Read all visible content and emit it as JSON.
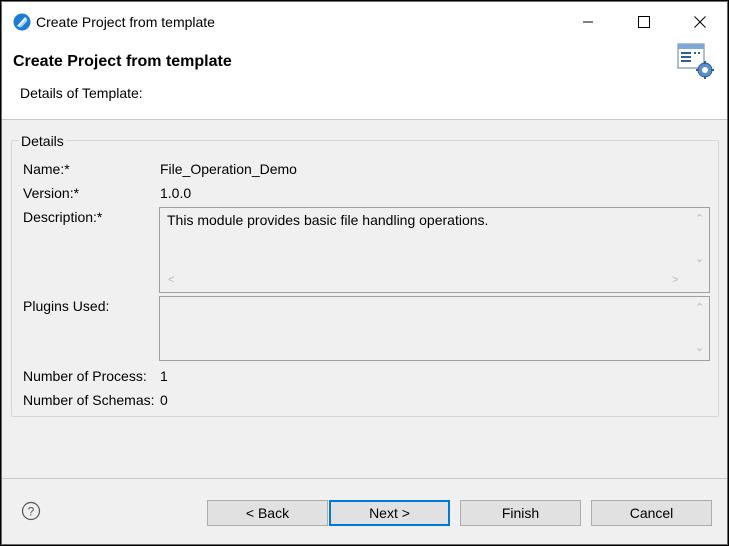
{
  "window": {
    "title": "Create Project from template"
  },
  "header": {
    "title": "Create Project from template",
    "subtitle": "Details of Template:"
  },
  "details": {
    "legend": "Details",
    "name_label": "Name:*",
    "name_value": "File_Operation_Demo",
    "version_label": "Version:*",
    "version_value": "1.0.0",
    "description_label": "Description:*",
    "description_value": "This module provides basic file handling operations.",
    "plugins_label": "Plugins Used:",
    "plugins_value": "",
    "processes_label": "Number of Process:",
    "processes_value": "1",
    "schemas_label": "Number of Schemas:",
    "schemas_value": "0"
  },
  "buttons": {
    "back": "< Back",
    "next": "Next >",
    "finish": "Finish",
    "cancel": "Cancel"
  },
  "icons": {
    "app": "app-logo-icon",
    "header": "template-settings-icon",
    "help": "help-icon"
  },
  "colors": {
    "accent": "#0078d7",
    "app_icon": "#1e7bd8"
  }
}
